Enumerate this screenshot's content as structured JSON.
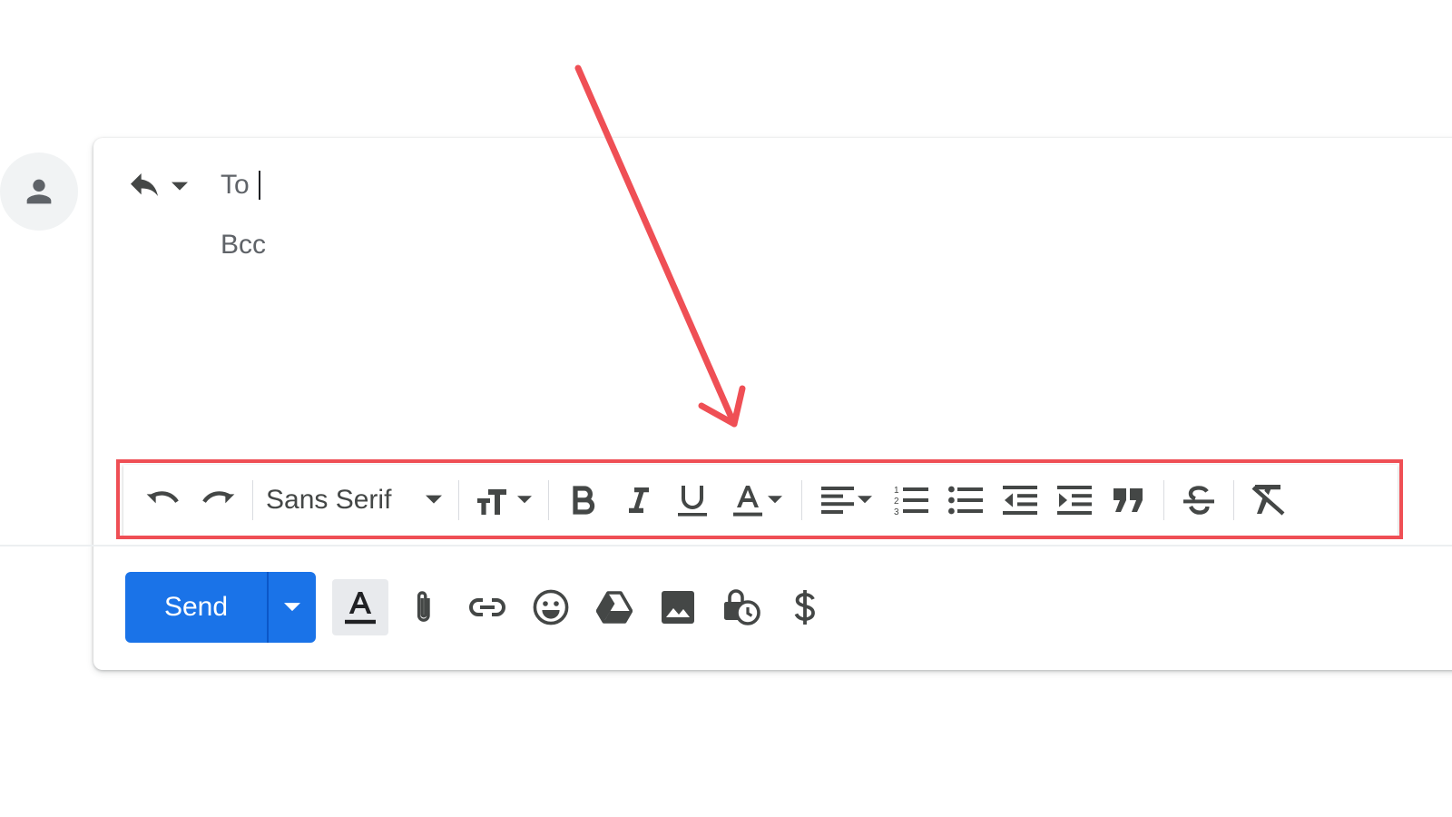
{
  "compose": {
    "to_label": "To",
    "bcc_label": "Bcc",
    "to_value": ""
  },
  "toolbar": {
    "font_family": "Sans Serif",
    "buttons": [
      "undo-icon",
      "redo-icon",
      "text-size-icon",
      "bold-icon",
      "italic-icon",
      "underline-icon",
      "text-color-icon",
      "align-icon",
      "numbered-list-icon",
      "bulleted-list-icon",
      "indent-less-icon",
      "indent-more-icon",
      "quote-icon",
      "strikethrough-icon",
      "remove-formatting-icon"
    ]
  },
  "bottom": {
    "send_label": "Send",
    "icons": [
      "formatting-options-icon",
      "attach-file-icon",
      "insert-link-icon",
      "emoji-icon",
      "google-drive-icon",
      "insert-photo-icon",
      "confidential-mode-icon",
      "dollar-icon"
    ]
  },
  "colors": {
    "send_button": "#1a73e8",
    "annotation": "#ef4f55",
    "icon": "#444746",
    "label": "#5f6368"
  }
}
